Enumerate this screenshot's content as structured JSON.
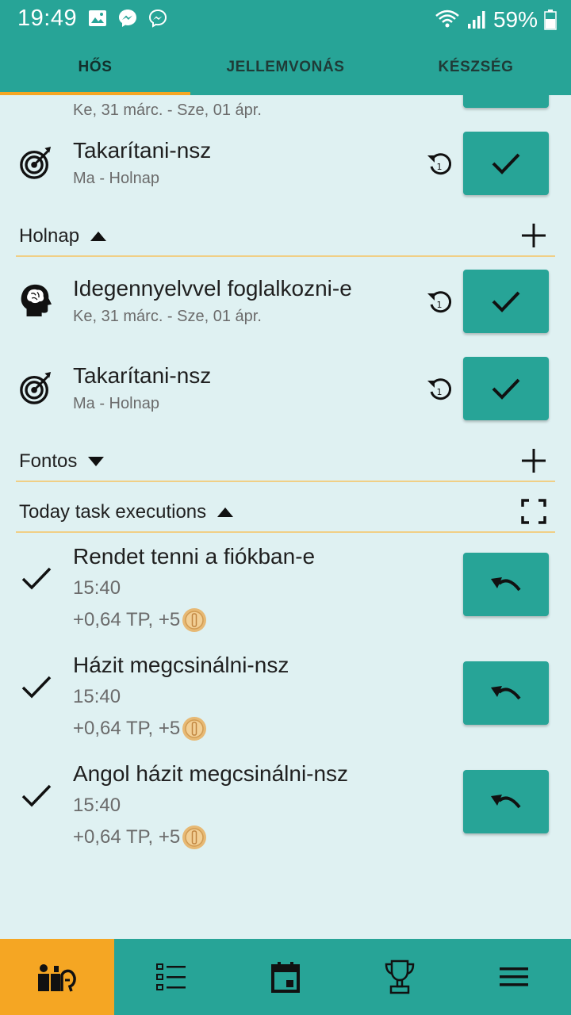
{
  "status_bar": {
    "time": "19:49",
    "battery": "59%",
    "icons": [
      "image-icon",
      "messenger-icon",
      "messenger-outline-icon",
      "wifi-icon",
      "signal-icon",
      "battery-icon"
    ]
  },
  "tabs": [
    {
      "label": "HŐS",
      "active": true
    },
    {
      "label": "JELLEMVONÁS",
      "active": false
    },
    {
      "label": "KÉSZSÉG",
      "active": false
    }
  ],
  "partial_row": {
    "sub": "Ke, 31 márc. - Sze, 01 ápr."
  },
  "today_tasks": [
    {
      "icon": "target-icon",
      "title": "Takarítani-nsz",
      "sub": "Ma - Holnap"
    }
  ],
  "sections": {
    "holnap": {
      "label": "Holnap",
      "expanded": true
    },
    "fontos": {
      "label": "Fontos",
      "expanded": false
    },
    "executions": {
      "label": "Today task executions",
      "expanded": true
    }
  },
  "holnap_tasks": [
    {
      "icon": "brain-head-icon",
      "title": "Idegennyelvvel foglalkozni-e",
      "sub": "Ke, 31 márc. - Sze, 01 ápr."
    },
    {
      "icon": "target-icon",
      "title": "Takarítani-nsz",
      "sub": "Ma - Holnap"
    }
  ],
  "executions": [
    {
      "title": "Rendet tenni a fiókban-e",
      "time": "15:40",
      "reward": "+0,64 TP, +5"
    },
    {
      "title": "Házit megcsinálni-nsz",
      "time": "15:40",
      "reward": "+0,64 TP, +5"
    },
    {
      "title": "Angol házit megcsinálni-nsz",
      "time": "15:40",
      "reward": "+0,64 TP, +5"
    }
  ],
  "bottom_nav": [
    {
      "icon": "hero-icon",
      "active": true
    },
    {
      "icon": "task-list-icon",
      "active": false
    },
    {
      "icon": "calendar-icon",
      "active": false
    },
    {
      "icon": "trophy-icon",
      "active": false
    },
    {
      "icon": "menu-icon",
      "active": false
    }
  ],
  "colors": {
    "primary": "#27a497",
    "accent": "#f5a623",
    "background": "#dff1f2",
    "divider": "#f0cf86"
  }
}
